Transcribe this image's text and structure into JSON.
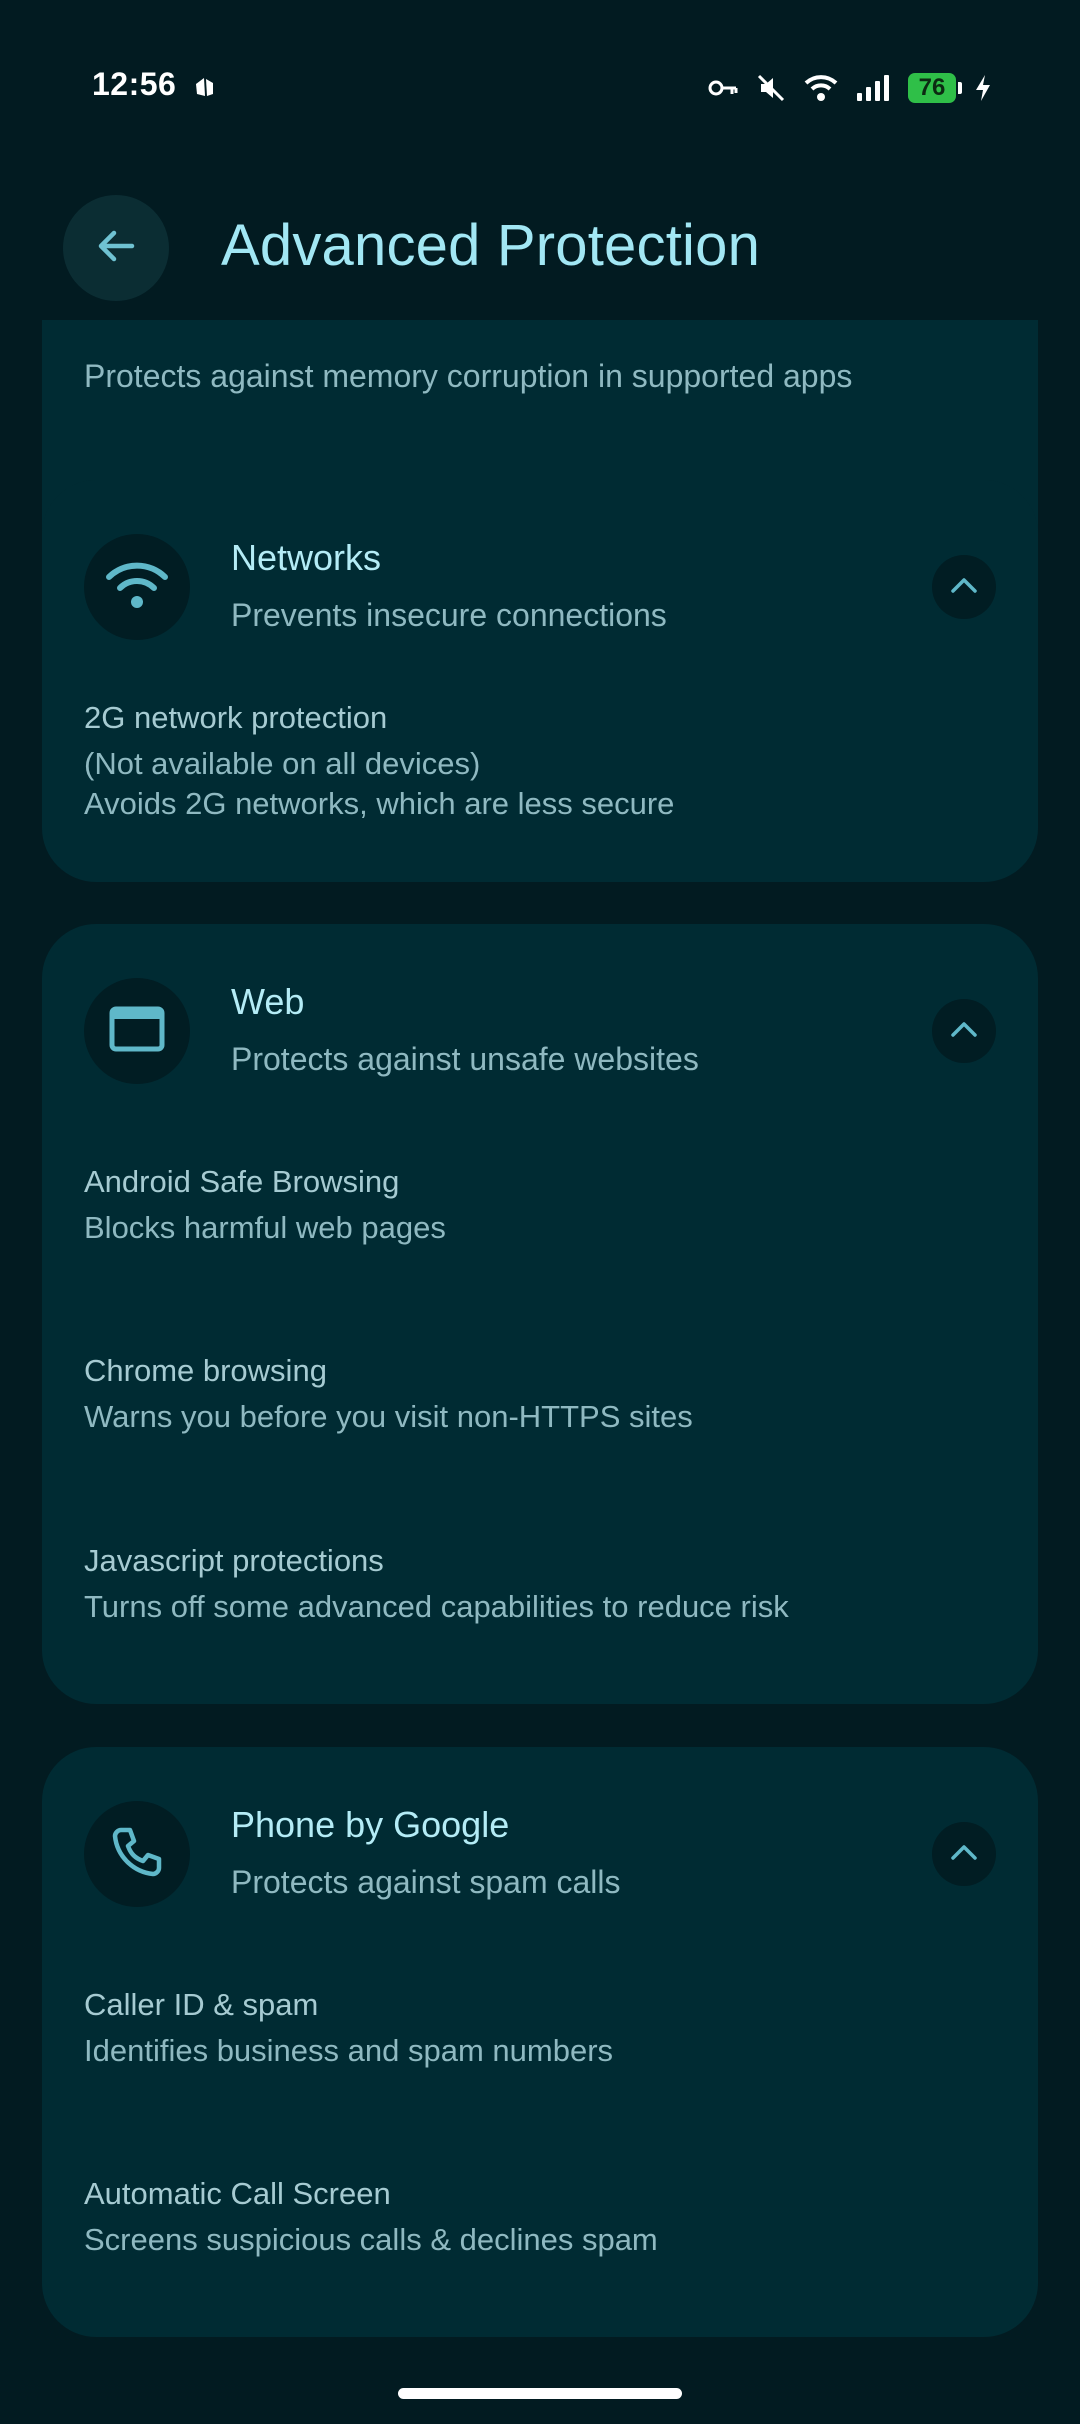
{
  "status_bar": {
    "time": "12:56",
    "battery_level": "76",
    "icons": [
      "notification-app-icon",
      "vpn-key-icon",
      "mute-icon",
      "wifi-icon",
      "cellular-signal-icon",
      "battery-icon",
      "charging-bolt-icon"
    ]
  },
  "app_bar": {
    "title": "Advanced Protection",
    "back_icon": "arrow-back-icon"
  },
  "partial_section": {
    "subtitle": "Protects against memory corruption in supported apps"
  },
  "sections": [
    {
      "title": "Networks",
      "subtitle": "Prevents insecure connections",
      "icon": "wifi-icon",
      "items": [
        {
          "title": "2G network protection",
          "desc": "(Not available on all devices)\nAvoids 2G networks, which are less secure"
        }
      ]
    },
    {
      "title": "Web",
      "subtitle": "Protects against unsafe websites",
      "icon": "browser-window-icon",
      "items": [
        {
          "title": "Android Safe Browsing",
          "desc": "Blocks harmful web pages"
        },
        {
          "title": "Chrome browsing",
          "desc": "Warns you before you visit non-HTTPS sites"
        },
        {
          "title": "Javascript protections",
          "desc": "Turns off some advanced capabilities to reduce risk"
        }
      ]
    },
    {
      "title": "Phone by Google",
      "subtitle": "Protects against spam calls",
      "icon": "phone-icon",
      "items": [
        {
          "title": "Caller ID & spam",
          "desc": "Identifies business and spam numbers"
        },
        {
          "title": "Automatic Call Screen",
          "desc": "Screens suspicious calls & declines spam"
        }
      ]
    }
  ],
  "colors": {
    "background": "#021b21",
    "card": "#002b33",
    "title": "#a2e7f4",
    "icon_accent": "#5fb8c9"
  }
}
